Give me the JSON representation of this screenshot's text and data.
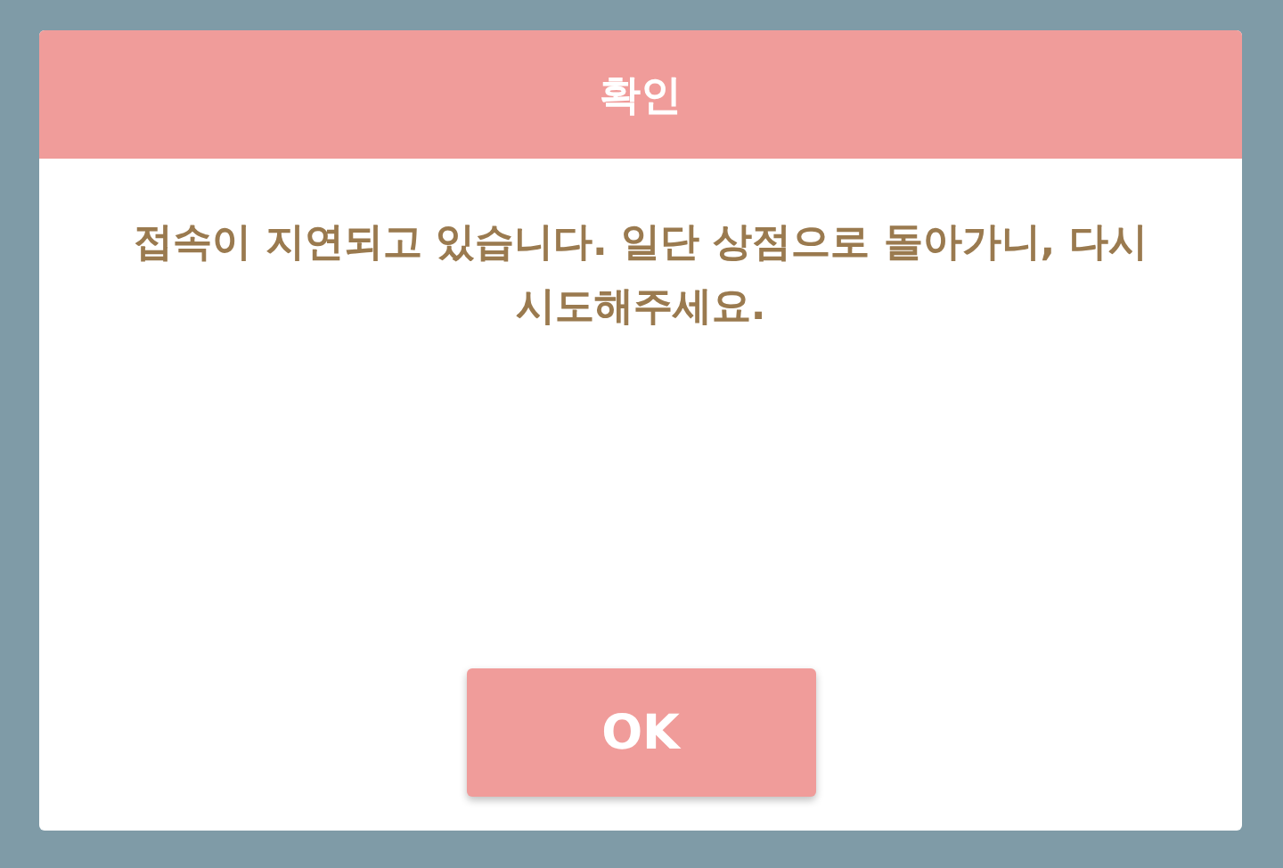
{
  "dialog": {
    "title": "확인",
    "message": "접속이 지연되고 있습니다. 일단 상점으로 돌아가니, 다시 시도해주세요.",
    "buttons": [
      {
        "label": "OK"
      }
    ]
  }
}
